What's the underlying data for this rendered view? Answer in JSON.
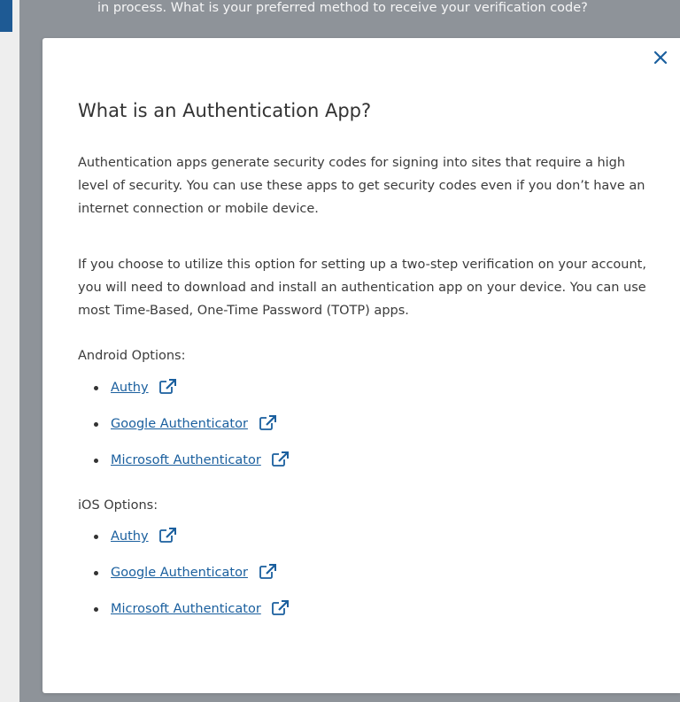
{
  "background": {
    "behind_text": "in process. What is your preferred method to receive your verification code?"
  },
  "modal": {
    "close_icon": "close-icon",
    "title": "What is an Authentication App?",
    "paragraph_1": "Authentication apps generate security codes for signing into sites that require a high level of security. You can use these apps to get security codes even if you don’t have an internet connection or mobile device.",
    "paragraph_2": "If you choose to utilize this option for setting up a two-step verification on your account, you will need to download and install an authentication app on your device. You can use most Time-Based, One-Time Password (TOTP) apps.",
    "android": {
      "label": "Android Options:",
      "items": [
        {
          "label": "Authy",
          "icon": "external-link-icon"
        },
        {
          "label": "Google Authenticator",
          "icon": "external-link-icon"
        },
        {
          "label": "Microsoft Authenticator",
          "icon": "external-link-icon"
        }
      ]
    },
    "ios": {
      "label": "iOS Options:",
      "items": [
        {
          "label": "Authy",
          "icon": "external-link-icon"
        },
        {
          "label": "Google Authenticator",
          "icon": "external-link-icon"
        },
        {
          "label": "Microsoft Authenticator",
          "icon": "external-link-icon"
        }
      ]
    }
  },
  "colors": {
    "link": "#1a5f9e",
    "overlay": "#8e9399",
    "accent": "#1e5a94"
  }
}
